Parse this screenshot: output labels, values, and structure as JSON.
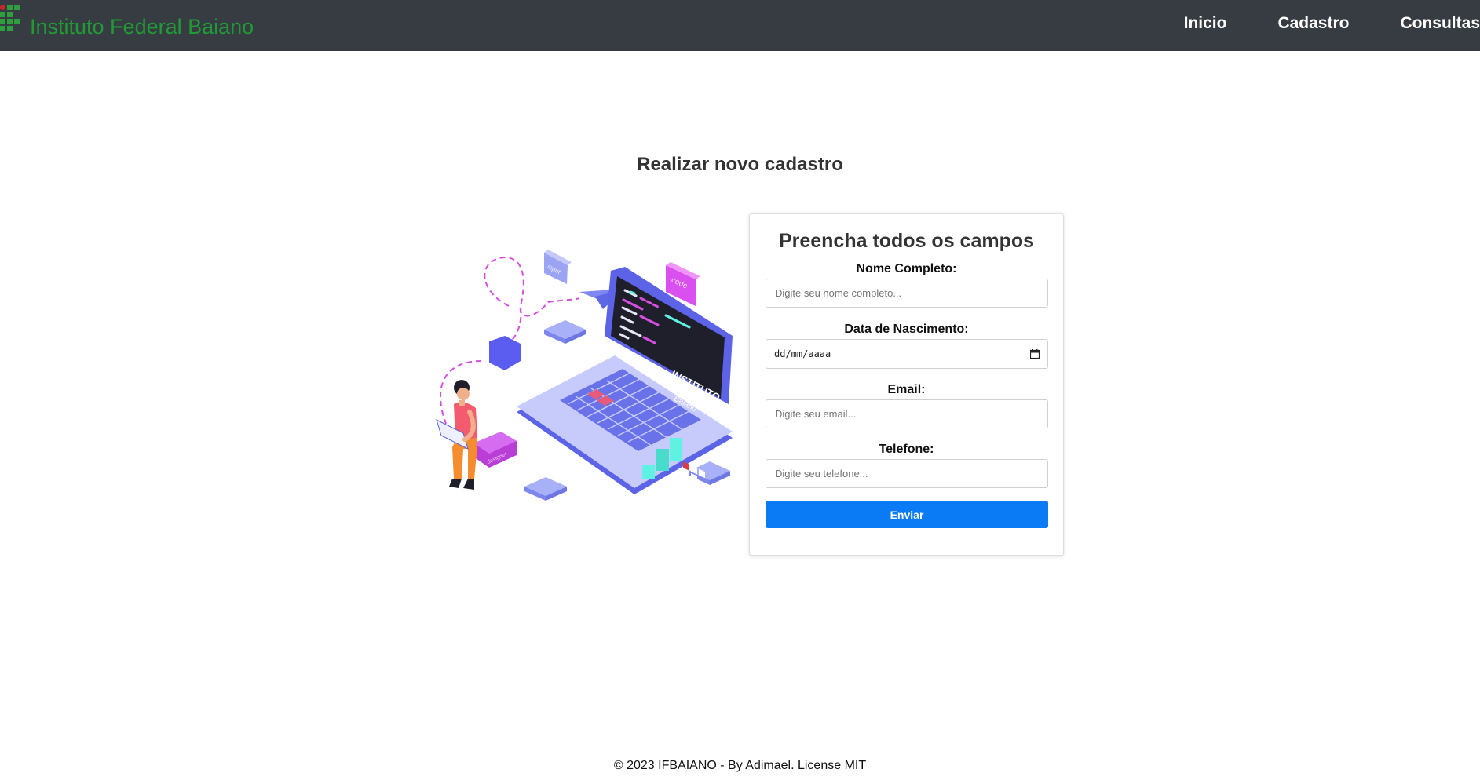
{
  "navbar": {
    "brand": "Instituto Federal Baiano",
    "links": [
      "Inicio",
      "Cadastro",
      "Consultas"
    ]
  },
  "page": {
    "title": "Realizar novo cadastro"
  },
  "illustration": {
    "labels": {
      "input": "input",
      "code": "code",
      "laptop_logo_line1": "INSTITUTO",
      "laptop_logo_line2": "FEDERAL",
      "laptop_logo_line3": "Baiano",
      "box": "designer"
    }
  },
  "form": {
    "title": "Preencha todos os campos",
    "name_label": "Nome Completo:",
    "name_placeholder": "Digite seu nome completo...",
    "birth_label": "Data de Nascimento:",
    "birth_placeholder": "dd/mm/aaaa",
    "email_label": "Email:",
    "email_placeholder": "Digite seu email...",
    "phone_label": "Telefone:",
    "phone_placeholder": "Digite seu telefone...",
    "submit_label": "Enviar"
  },
  "footer": {
    "text": "© 2023 IFBAIANO - By Adimael. License MIT"
  },
  "colors": {
    "navbar_bg": "#373c43",
    "brand_green": "#1f9a34",
    "primary_button": "#0b7bf5"
  }
}
